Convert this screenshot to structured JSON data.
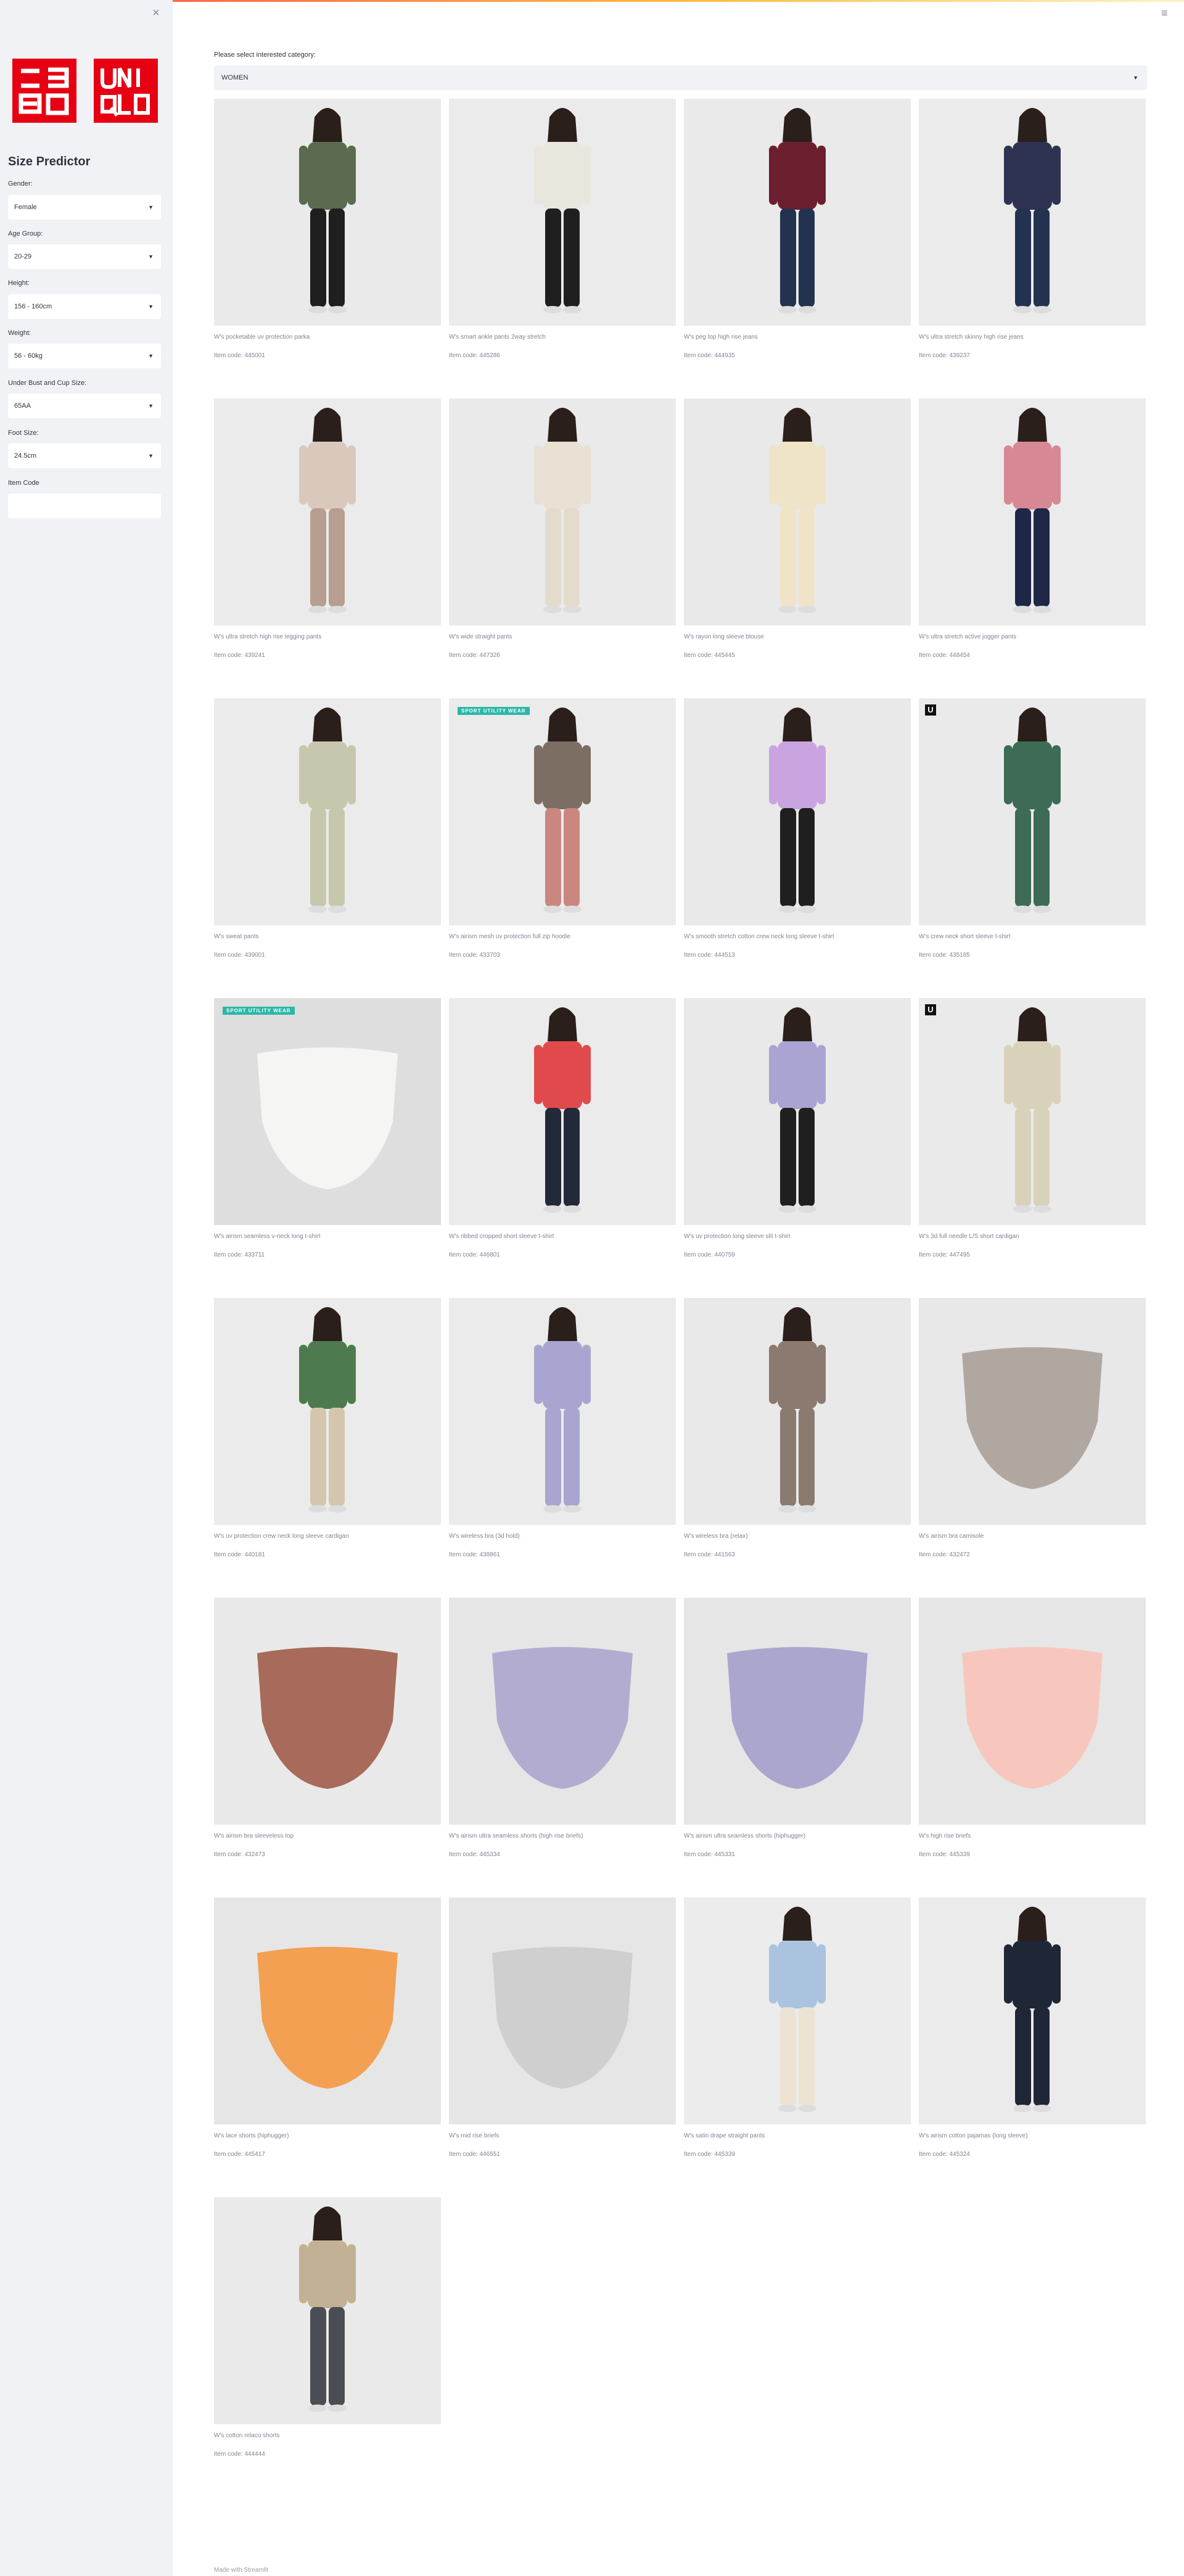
{
  "sidebar": {
    "close_icon": "×",
    "logo": {
      "top": "ユニ\nクロ",
      "bottom": "UNI\nQLO"
    },
    "title": "Size Predictor",
    "fields": {
      "gender": {
        "label": "Gender:",
        "value": "Female"
      },
      "age_group": {
        "label": "Age Group:",
        "value": "20-29"
      },
      "height": {
        "label": "Height:",
        "value": "156 - 160cm"
      },
      "weight": {
        "label": "Weight:",
        "value": "56 - 60kg"
      },
      "bust_cup": {
        "label": "Under Bust and Cup Size:",
        "value": "65AA"
      },
      "foot_size": {
        "label": "Foot Size:",
        "value": "24.5cm"
      },
      "item_code": {
        "label": "Item Code",
        "value": ""
      }
    }
  },
  "header": {
    "menu_icon": "≡"
  },
  "category": {
    "label": "Please select interested category:",
    "value": "WOMEN"
  },
  "products": [
    {
      "name": "W's pocketable uv protection parka",
      "code": "Item code: 445001",
      "bg": "#eaeaea"
    },
    {
      "name": "W's smart ankle pants 2way stretch",
      "code": "Item code: 445286",
      "bg": "#ebebeb"
    },
    {
      "name": "W's peg top high rise jeans",
      "code": "Item code: 444935",
      "bg": "#eaeaea"
    },
    {
      "name": "W's ultra stretch skinny high rise jeans",
      "code": "Item code: 439237",
      "bg": "#ebebeb"
    },
    {
      "name": "W's ultra stretch high rise legging pants",
      "code": "Item code: 439241",
      "bg": "#ebebeb"
    },
    {
      "name": "W's wide straight pants",
      "code": "Item code: 447326",
      "bg": "#eaeaea"
    },
    {
      "name": "W's rayon long sleeve blouse",
      "code": "Item code: 445445",
      "bg": "#e9e9e9"
    },
    {
      "name": "W's ultra stretch active jogger pants",
      "code": "Item code: 448454",
      "bg": "#ebebeb"
    },
    {
      "name": "W's sweat pants",
      "code": "Item code: 439001",
      "bg": "#ebebeb"
    },
    {
      "name": "W's airism mesh uv protection full zip hoodie",
      "code": "Item code: 433703",
      "bg": "#ebebeb",
      "badge": "SPORT UTILITY WEAR"
    },
    {
      "name": "W's smooth stretch cotton crew neck long sleeve t-shirt",
      "code": "Item code: 444513",
      "bg": "#e9e9e9"
    },
    {
      "name": "W's crew neck short sleeve t-shirt",
      "code": "Item code: 435185",
      "bg": "#eaeaea",
      "badge": "U"
    },
    {
      "name": "W's airism seamless v-neck long t-shirt",
      "code": "Item code: 433711",
      "bg": "#dedede",
      "badge": "SPORT UTILITY WEAR"
    },
    {
      "name": "W's ribbed cropped short sleeve t-shirt",
      "code": "Item code: 446801",
      "bg": "#ebebeb"
    },
    {
      "name": "W's uv protection long sleeve slit t-shirt",
      "code": "Item code: 440759",
      "bg": "#e9e9e9"
    },
    {
      "name": "W's 3d full needle L/S short cardigan",
      "code": "Item code: 447495",
      "bg": "#eaeaea",
      "badge": "U"
    },
    {
      "name": "W's uv protection crew neck long sleeve cardigan",
      "code": "Item code: 440181",
      "bg": "#ebebeb"
    },
    {
      "name": "W's wireless bra (3d hold)",
      "code": "Item code: 438861",
      "bg": "#ebebeb"
    },
    {
      "name": "W's wireless bra (relax)",
      "code": "Item code: 441563",
      "bg": "#e9e9e9"
    },
    {
      "name": "W's airism bra camisole",
      "code": "Item code: 432472",
      "bg": "#e8e8e8"
    },
    {
      "name": "W's airism bra sleeveless top",
      "code": "Item code: 432473",
      "bg": "#e9e9e9"
    },
    {
      "name": "W's airism ultra seamless shorts (high rise briefs)",
      "code": "Item code: 445334",
      "bg": "#e6e6e6"
    },
    {
      "name": "W's airism ultra seamless shorts (hiphugger)",
      "code": "Item code: 445331",
      "bg": "#e6e6e6"
    },
    {
      "name": "W's high rise briefs",
      "code": "Item code: 445339",
      "bg": "#e6e6e6"
    },
    {
      "name": "W's lace shorts (hiphugger)",
      "code": "Item code: 445417",
      "bg": "#e6e6e6"
    },
    {
      "name": "W's mid rise briefs",
      "code": "Item code: 446551",
      "bg": "#e6e6e6"
    },
    {
      "name": "W's satin drape straight pants",
      "code": "Item code: 445339",
      "bg": "#ececec"
    },
    {
      "name": "W's airism cotton pajamas (long sleeve)",
      "code": "Item code: 445324",
      "bg": "#ebebeb"
    },
    {
      "name": "W's cotton relaco shorts",
      "code": "Item code: 444444",
      "bg": "#eaeaea"
    }
  ],
  "footer": {
    "prefix": "Made with",
    "link": "Streamlit"
  },
  "colors": {
    "brand_red": "#e60012",
    "badge_teal": "#2ab7a9",
    "sidebar_bg": "#f0f2f6"
  }
}
